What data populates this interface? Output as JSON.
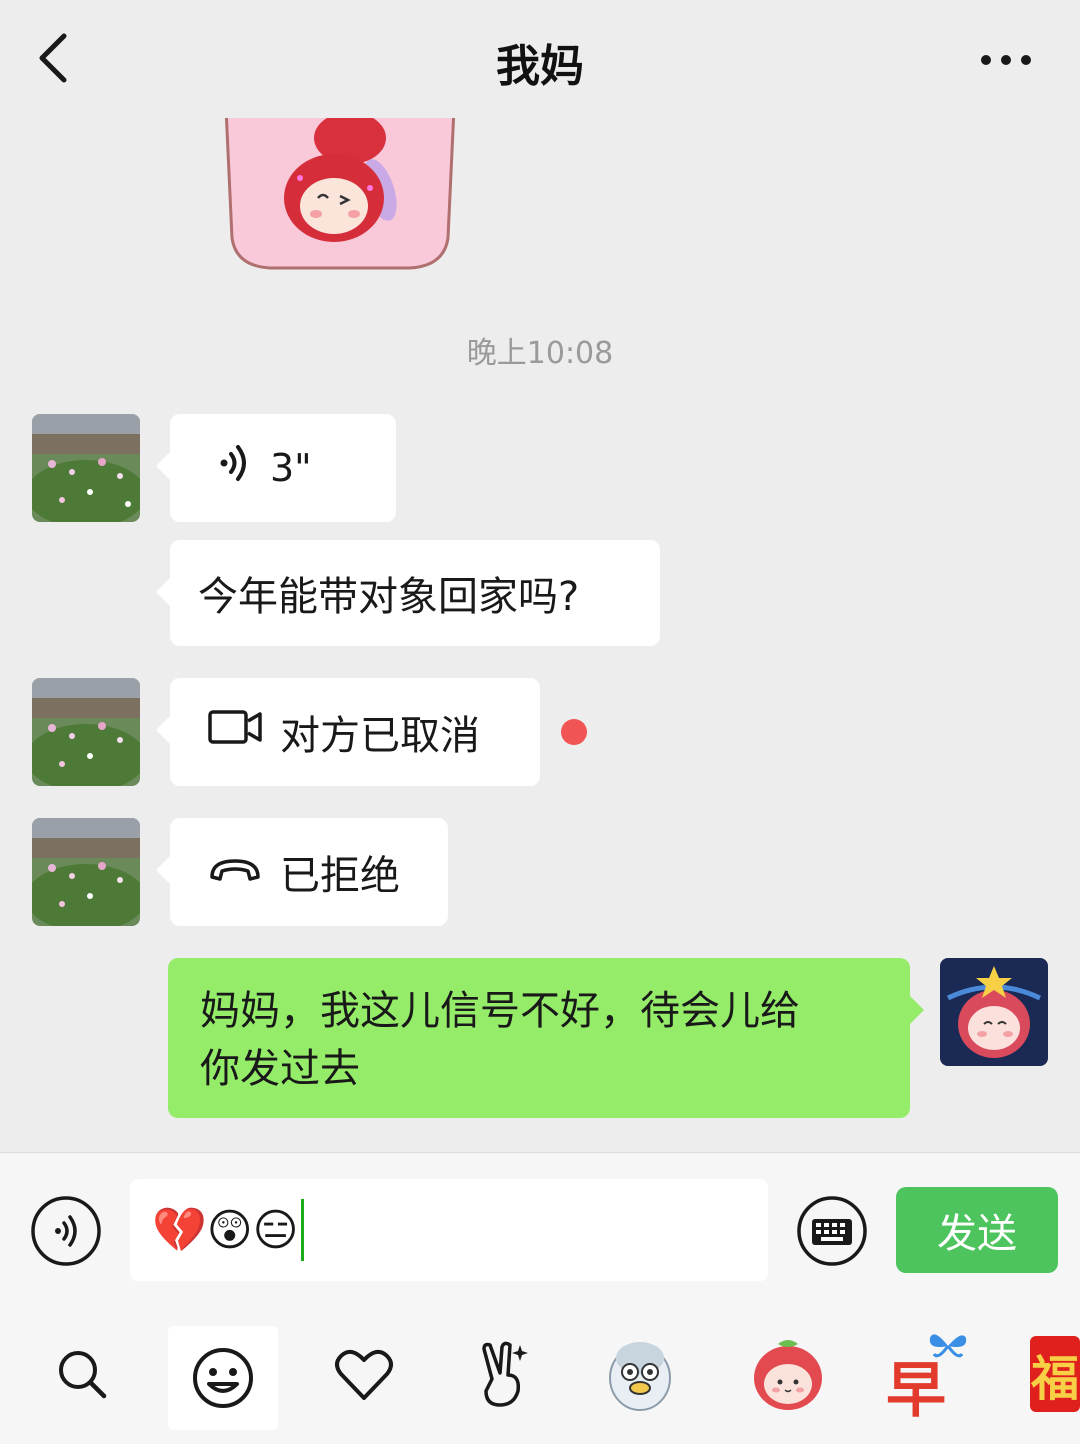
{
  "header": {
    "title": "我妈",
    "back_icon": "chevron-left-icon",
    "more_icon": "more-dots-icon"
  },
  "timestamp": "晚上10:08",
  "messages": [
    {
      "type": "voice",
      "side": "left",
      "duration": "3\""
    },
    {
      "type": "text",
      "side": "left",
      "text": "今年能带对象回家吗?"
    },
    {
      "type": "video-call",
      "side": "left",
      "text": "对方已取消"
    },
    {
      "type": "voice-call",
      "side": "left",
      "text": "已拒绝"
    },
    {
      "type": "text",
      "side": "right",
      "text_line1": "妈妈，我这儿信号不好，待会儿给",
      "text_line2": "你发过去"
    }
  ],
  "input": {
    "value": "💔😲😑",
    "send_label": "发送"
  },
  "colors": {
    "self_bubble": "#95ec69",
    "send_button": "#4ec45e",
    "unread_dot": "#f05454",
    "background": "#ededed"
  },
  "emoji_tabs": [
    "search-icon",
    "smiley-icon",
    "heart-icon",
    "victory-hand-icon",
    "penguin-sticker",
    "strawberry-sticker",
    "zao-sticker",
    "fu-sticker"
  ],
  "zao_char": "早",
  "fu_char": "福"
}
